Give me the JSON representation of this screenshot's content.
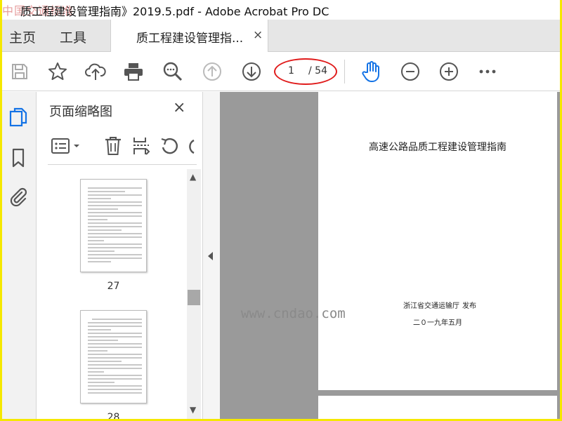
{
  "window": {
    "title": "质工程建设管理指南》2019.5.pdf - Adobe Acrobat Pro DC",
    "watermark": "中国交通标准"
  },
  "menu": {
    "home": "主页",
    "tools": "工具"
  },
  "tab": {
    "label": "质工程建设管理指...",
    "close": "×"
  },
  "toolbar": {
    "current_page": "1",
    "total_pages": "/ 54",
    "icons": [
      "save-icon",
      "star-icon",
      "cloud-upload-icon",
      "print-icon",
      "zoom-search-icon",
      "page-up-icon",
      "page-down-icon",
      "hand-icon",
      "zoom-out-icon",
      "zoom-in-icon",
      "more-icon"
    ]
  },
  "rail": {
    "icons": [
      "page-thumbnails-icon",
      "bookmark-icon",
      "attachment-icon"
    ]
  },
  "panel": {
    "title": "页面缩略图",
    "close": "×",
    "tools": [
      "options-icon",
      "delete-icon",
      "extract-icon",
      "rotate-icon"
    ],
    "thumbnails": [
      {
        "page": "27"
      },
      {
        "page": "28"
      }
    ]
  },
  "document": {
    "title": "高速公路品质工程建设管理指南",
    "publisher": "浙江省交通运输厅",
    "publish_word": "发布",
    "date": "二０一九年五月"
  },
  "site_watermark": "www.cndao.com",
  "colors": {
    "accent": "#1473e6",
    "highlight": "#e01b1b",
    "border": "#f5e800"
  }
}
